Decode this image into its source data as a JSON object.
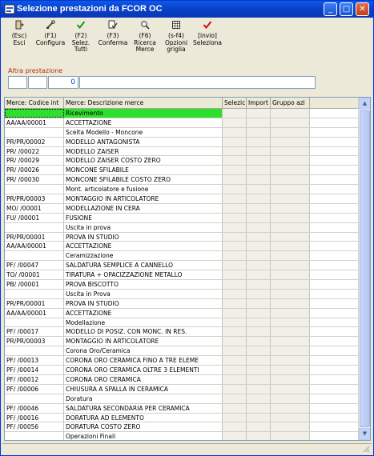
{
  "window": {
    "title": "Selezione prestazioni da FCOR OC"
  },
  "toolbar": [
    {
      "key": "(Esc)",
      "label": "Esci",
      "icon": "exit-door-icon"
    },
    {
      "key": "(F1)",
      "label": "Configura",
      "icon": "configure-icon"
    },
    {
      "key": "(F2)",
      "label": "Selez.\nTutti",
      "icon": "check-green-icon"
    },
    {
      "key": "(F3)",
      "label": "Conferma",
      "icon": "confirm-icon"
    },
    {
      "key": "(F6)",
      "label": "Ricerca\nMerce",
      "icon": "search-icon"
    },
    {
      "key": "(s-f4)",
      "label": "Opzioni\ngriglia",
      "icon": "grid-options-icon"
    },
    {
      "key": "[invio]",
      "label": "Seleziona",
      "icon": "check-red-icon"
    }
  ],
  "altra": {
    "label": "Altra prestazione",
    "code_value": "0"
  },
  "grid": {
    "columns": [
      "Merce: Codice int",
      "Merce: Descrizione merce",
      "Selezic",
      "Import",
      "Gruppo azi"
    ],
    "rows": [
      {
        "code": "",
        "desc": "Ricevimento"
      },
      {
        "code": "AA/AA/00001",
        "desc": "ACCETTAZIONE"
      },
      {
        "code": "",
        "desc": "Scelta Modello - Moncone"
      },
      {
        "code": "PR/PR/00002",
        "desc": "MODELLO ANTAGONISTA"
      },
      {
        "code": "PR/  /00022",
        "desc": "MODELLO ZAISER"
      },
      {
        "code": "PR/  /00029",
        "desc": "MODELLO ZAISER COSTO ZERO"
      },
      {
        "code": "PR/  /00026",
        "desc": "MONCONE SFILABILE"
      },
      {
        "code": "PR/  /00030",
        "desc": "MONCONE SFILABILE COSTO ZERO"
      },
      {
        "code": "",
        "desc": "Mont. articolatore e fusione"
      },
      {
        "code": "PR/PR/00003",
        "desc": "MONTAGGIO IN ARTICOLATORE"
      },
      {
        "code": "MO/  /00001",
        "desc": "MODELLAZIONE IN CERA"
      },
      {
        "code": "FU/  /00001",
        "desc": "FUSIONE"
      },
      {
        "code": "",
        "desc": "Uscita in prova"
      },
      {
        "code": "PR/PR/00001",
        "desc": "PROVA IN STUDIO"
      },
      {
        "code": "AA/AA/00001",
        "desc": "ACCETTAZIONE"
      },
      {
        "code": "",
        "desc": "Ceramizzazione"
      },
      {
        "code": "PF/  /00047",
        "desc": "SALDATURA SEMPLICE A CANNELLO"
      },
      {
        "code": "TO/  /00001",
        "desc": "TIRATURA + OPACIZZAZIONE METALLO"
      },
      {
        "code": "PB/  /00001",
        "desc": "PROVA BISCOTTO"
      },
      {
        "code": "",
        "desc": "Uscita in Prova"
      },
      {
        "code": "PR/PR/00001",
        "desc": "PROVA IN STUDIO"
      },
      {
        "code": "AA/AA/00001",
        "desc": "ACCETTAZIONE"
      },
      {
        "code": "",
        "desc": "Modellazione"
      },
      {
        "code": "PF/  /00017",
        "desc": "MODELLO DI POSIZ. CON MONC. IN RES."
      },
      {
        "code": "PR/PR/00003",
        "desc": "MONTAGGIO IN ARTICOLATORE"
      },
      {
        "code": "",
        "desc": "Corona Oro/Ceramica"
      },
      {
        "code": "PF/  /00013",
        "desc": "CORONA ORO CERAMICA FINO A TRE ELEME"
      },
      {
        "code": "PF/  /00014",
        "desc": "CORONA ORO CERAMICA OLTRE 3 ELEMENTI"
      },
      {
        "code": "PF/  /00012",
        "desc": "CORONA ORO CERAMICA"
      },
      {
        "code": "PF/  /00006",
        "desc": "CHIUSURA A SPALLA IN CERAMICA"
      },
      {
        "code": "",
        "desc": "Doratura"
      },
      {
        "code": "PF/  /00046",
        "desc": "SALDATURA SECONDARIA PER CERAMICA"
      },
      {
        "code": "PF/  /00016",
        "desc": "DORATURA AD ELEMENTO"
      },
      {
        "code": "PF/  /00056",
        "desc": "DORATURA COSTO ZERO"
      },
      {
        "code": "",
        "desc": "Operazioni Finali"
      }
    ]
  },
  "colors": {
    "highlight": "#2ee02e",
    "titlebar": "#0a5ae6",
    "label_red": "#b03010"
  }
}
